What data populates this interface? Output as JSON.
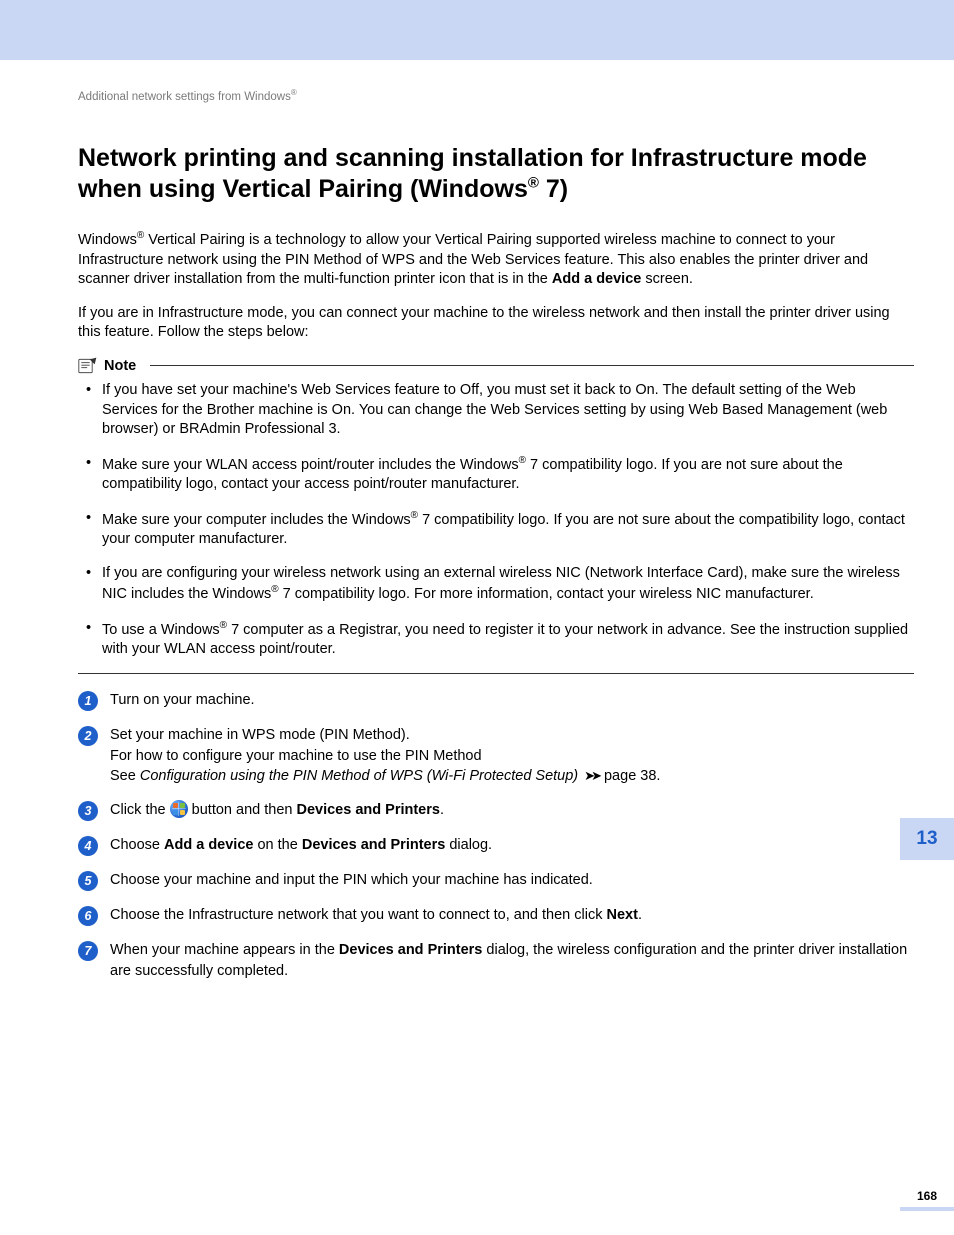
{
  "breadcrumb": {
    "text": "Additional network settings from Windows",
    "mark": "®"
  },
  "title": {
    "part1": "Network printing and scanning installation for Infrastructure mode when using Vertical Pairing (Windows",
    "mark": "®",
    "part2": " 7)"
  },
  "intro": {
    "p1a": "Windows",
    "p1mark": "®",
    "p1b": " Vertical Pairing is a technology to allow your Vertical Pairing supported wireless machine to connect to your Infrastructure network using the PIN Method of WPS and the Web Services feature. This also enables the printer driver and scanner driver installation from the multi-function printer icon that is in the ",
    "p1bold": "Add a device",
    "p1c": " screen.",
    "p2": "If you are in Infrastructure mode, you can connect your machine to the wireless network and then install the printer driver using this feature. Follow the steps below:"
  },
  "note": {
    "label": "Note",
    "items": [
      {
        "text": "If you have set your machine's Web Services feature to Off, you must set it back to On. The default setting of the Web Services for the Brother machine is On. You can change the Web Services setting by using Web Based Management (web browser) or BRAdmin Professional 3."
      },
      {
        "pre": "Make sure your WLAN access point/router includes the Windows",
        "mark": "®",
        "post": " 7 compatibility logo. If you are not sure about the compatibility logo, contact your access point/router manufacturer."
      },
      {
        "pre": "Make sure your computer includes the Windows",
        "mark": "®",
        "post": " 7 compatibility logo. If you are not sure about the compatibility logo, contact your computer manufacturer."
      },
      {
        "pre": "If you are configuring your wireless network using an external wireless NIC (Network Interface Card), make sure the wireless NIC includes the Windows",
        "mark": "®",
        "post": " 7 compatibility logo. For more information, contact your wireless NIC manufacturer."
      },
      {
        "pre": "To use a Windows",
        "mark": "®",
        "post": " 7 computer as a Registrar, you need to register it to your network in advance. See the instruction supplied with your WLAN access point/router."
      }
    ]
  },
  "steps": {
    "s1": {
      "num": "1",
      "text": "Turn on your machine."
    },
    "s2": {
      "num": "2",
      "l1": "Set your machine in WPS mode (PIN Method).",
      "l2": "For how to configure your machine to use the PIN Method",
      "l3a": "See ",
      "l3italic": "Configuration using the PIN Method of WPS (Wi-Fi Protected Setup)",
      "l3b": " page 38."
    },
    "s3": {
      "num": "3",
      "a": "Click the ",
      "b": " button and then ",
      "bold": "Devices and Printers",
      "c": "."
    },
    "s4": {
      "num": "4",
      "a": "Choose ",
      "bold1": "Add a device",
      "b": " on the ",
      "bold2": "Devices and Printers",
      "c": " dialog."
    },
    "s5": {
      "num": "5",
      "text": "Choose your machine and input the PIN which your machine has indicated."
    },
    "s6": {
      "num": "6",
      "a": "Choose the Infrastructure network that you want to connect to, and then click ",
      "bold": "Next",
      "b": "."
    },
    "s7": {
      "num": "7",
      "a": "When your machine appears in the ",
      "bold": "Devices and Printers",
      "b": " dialog, the wireless configuration and the printer driver installation are successfully completed."
    }
  },
  "sidebar": {
    "chapter": "13"
  },
  "footer": {
    "page": "168"
  },
  "glyphs": {
    "arrows": "➤➤"
  }
}
